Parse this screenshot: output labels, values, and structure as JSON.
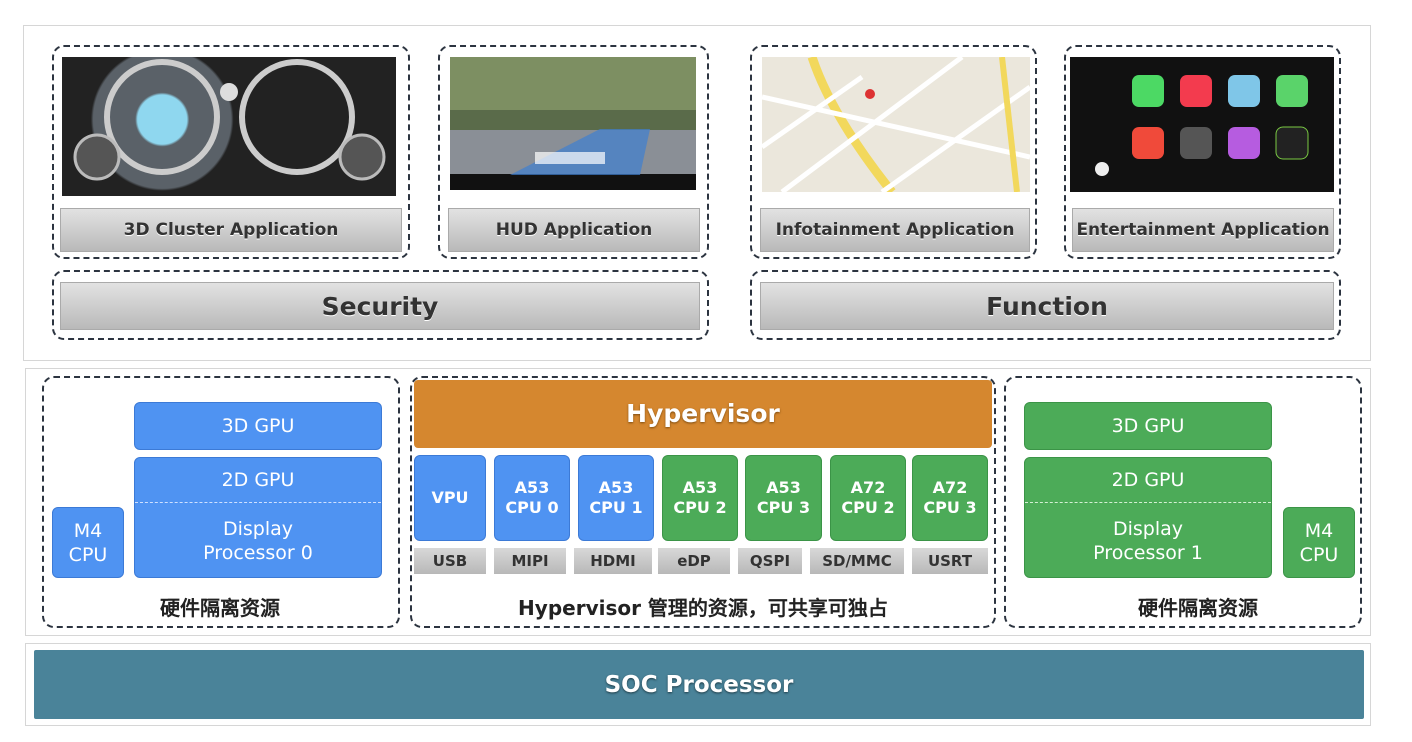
{
  "applications": [
    {
      "label": "3D Cluster Application",
      "image": "instrument-cluster-image"
    },
    {
      "label": "HUD Application",
      "image": "hud-road-image"
    },
    {
      "label": "Infotainment Application",
      "image": "map-image"
    },
    {
      "label": "Entertainment Application",
      "image": "carplay-home-image"
    }
  ],
  "domains": {
    "security": "Security",
    "function": "Function"
  },
  "left": {
    "gpu3d": "3D GPU",
    "gpu2d": "2D GPU",
    "display": "Display Processor 0",
    "m4": "M4 CPU",
    "caption": "硬件隔离资源"
  },
  "right": {
    "gpu3d": "3D GPU",
    "gpu2d": "2D GPU",
    "display": "Display Processor 1",
    "m4": "M4 CPU",
    "caption": "硬件隔离资源"
  },
  "hypervisor": {
    "title": "Hypervisor",
    "cores": [
      {
        "l1": "VPU",
        "l2": "",
        "color": "blue"
      },
      {
        "l1": "A53",
        "l2": "CPU 0",
        "color": "blue"
      },
      {
        "l1": "A53",
        "l2": "CPU 1",
        "color": "blue"
      },
      {
        "l1": "A53",
        "l2": "CPU 2",
        "color": "green"
      },
      {
        "l1": "A53",
        "l2": "CPU 3",
        "color": "green"
      },
      {
        "l1": "A72",
        "l2": "CPU 2",
        "color": "green"
      },
      {
        "l1": "A72",
        "l2": "CPU 3",
        "color": "green"
      }
    ],
    "interfaces": [
      "USB",
      "MIPI",
      "HDMI",
      "eDP",
      "QSPI",
      "SD/MMC",
      "USRT"
    ],
    "caption": "Hypervisor 管理的资源，可共享可独占"
  },
  "soc": "SOC Processor",
  "colors": {
    "blue": "#4f93f2",
    "green": "#4cab58",
    "hypervisor": "#d5872f",
    "soc": "#4a8399"
  }
}
